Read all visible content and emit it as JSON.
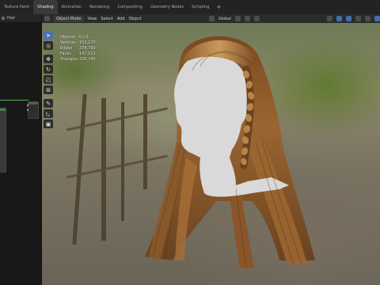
{
  "topbar": {
    "tabs": [
      {
        "label": "Texture Paint",
        "active": false
      },
      {
        "label": "Shading",
        "active": true
      },
      {
        "label": "Animation",
        "active": false
      },
      {
        "label": "Rendering",
        "active": false
      },
      {
        "label": "Compositing",
        "active": false
      },
      {
        "label": "Geometry Nodes",
        "active": false
      },
      {
        "label": "Scripting",
        "active": false
      }
    ],
    "add_label": "+"
  },
  "leftpanel": {
    "title": "Hair"
  },
  "viewport_header": {
    "mode": "Object Mode",
    "menu": [
      "View",
      "Select",
      "Add",
      "Object"
    ],
    "orientation": "Global"
  },
  "stats": [
    {
      "key": "Objects",
      "value": "0 / 3"
    },
    {
      "key": "Vertices",
      "value": "153,177"
    },
    {
      "key": "Edges",
      "value": "278,790"
    },
    {
      "key": "Faces",
      "value": "147,121"
    },
    {
      "key": "Triangles",
      "value": "235,745"
    }
  ],
  "tools": [
    {
      "name": "select-tool",
      "glyph": "➤",
      "active": true
    },
    {
      "name": "cursor-tool",
      "glyph": "◎",
      "active": false
    },
    {
      "name": "move-tool",
      "glyph": "✥",
      "active": false
    },
    {
      "name": "rotate-tool",
      "glyph": "↻",
      "active": false
    },
    {
      "name": "scale-tool",
      "glyph": "◰",
      "active": false
    },
    {
      "name": "transform-tool",
      "glyph": "⊞",
      "active": false
    },
    {
      "name": "annotate-tool",
      "glyph": "✎",
      "active": false
    },
    {
      "name": "measure-tool",
      "glyph": "◺",
      "active": false
    },
    {
      "name": "add-cube-tool",
      "glyph": "▣",
      "active": false
    }
  ],
  "colors": {
    "accent": "#4a72b0",
    "hair_dark": "#5a3618",
    "hair_mid": "#9a6530",
    "hair_light": "#c99a5e",
    "head_mannequin": "#d9d9d9"
  }
}
